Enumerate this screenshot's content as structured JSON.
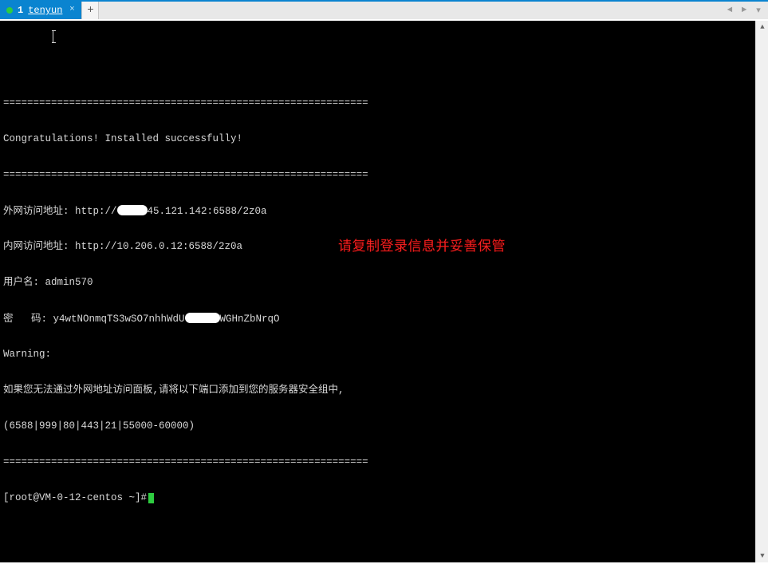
{
  "tabs": {
    "active": {
      "num": "1",
      "label": "tenyun"
    }
  },
  "overlay": "请复制登录信息并妥善保管",
  "terminal": {
    "divider_top": "=============================================================",
    "congrats": "Congratulations! Installed successfully!",
    "divider_mid": "=============================================================",
    "ext_pre": "外网访问地址: http://",
    "ext_post": "45.121.142:6588/2z0a",
    "int_line": "内网访问地址: http://10.206.0.12:6588/2z0a",
    "user_line": "用户名: admin570",
    "pass_pre": "密   码: y4wtNOnmqTS3wSO7nhhWdU",
    "pass_post": "WGHnZbNrqO",
    "warning": "Warning:",
    "warn_line": "如果您无法通过外网地址访问面板,请将以下端口添加到您的服务器安全组中,",
    "ports_line": "(6588|999|80|443|21|55000-60000)",
    "divider_bot": "=============================================================",
    "prompt": "[root@VM-0-12-centos ~]#"
  }
}
